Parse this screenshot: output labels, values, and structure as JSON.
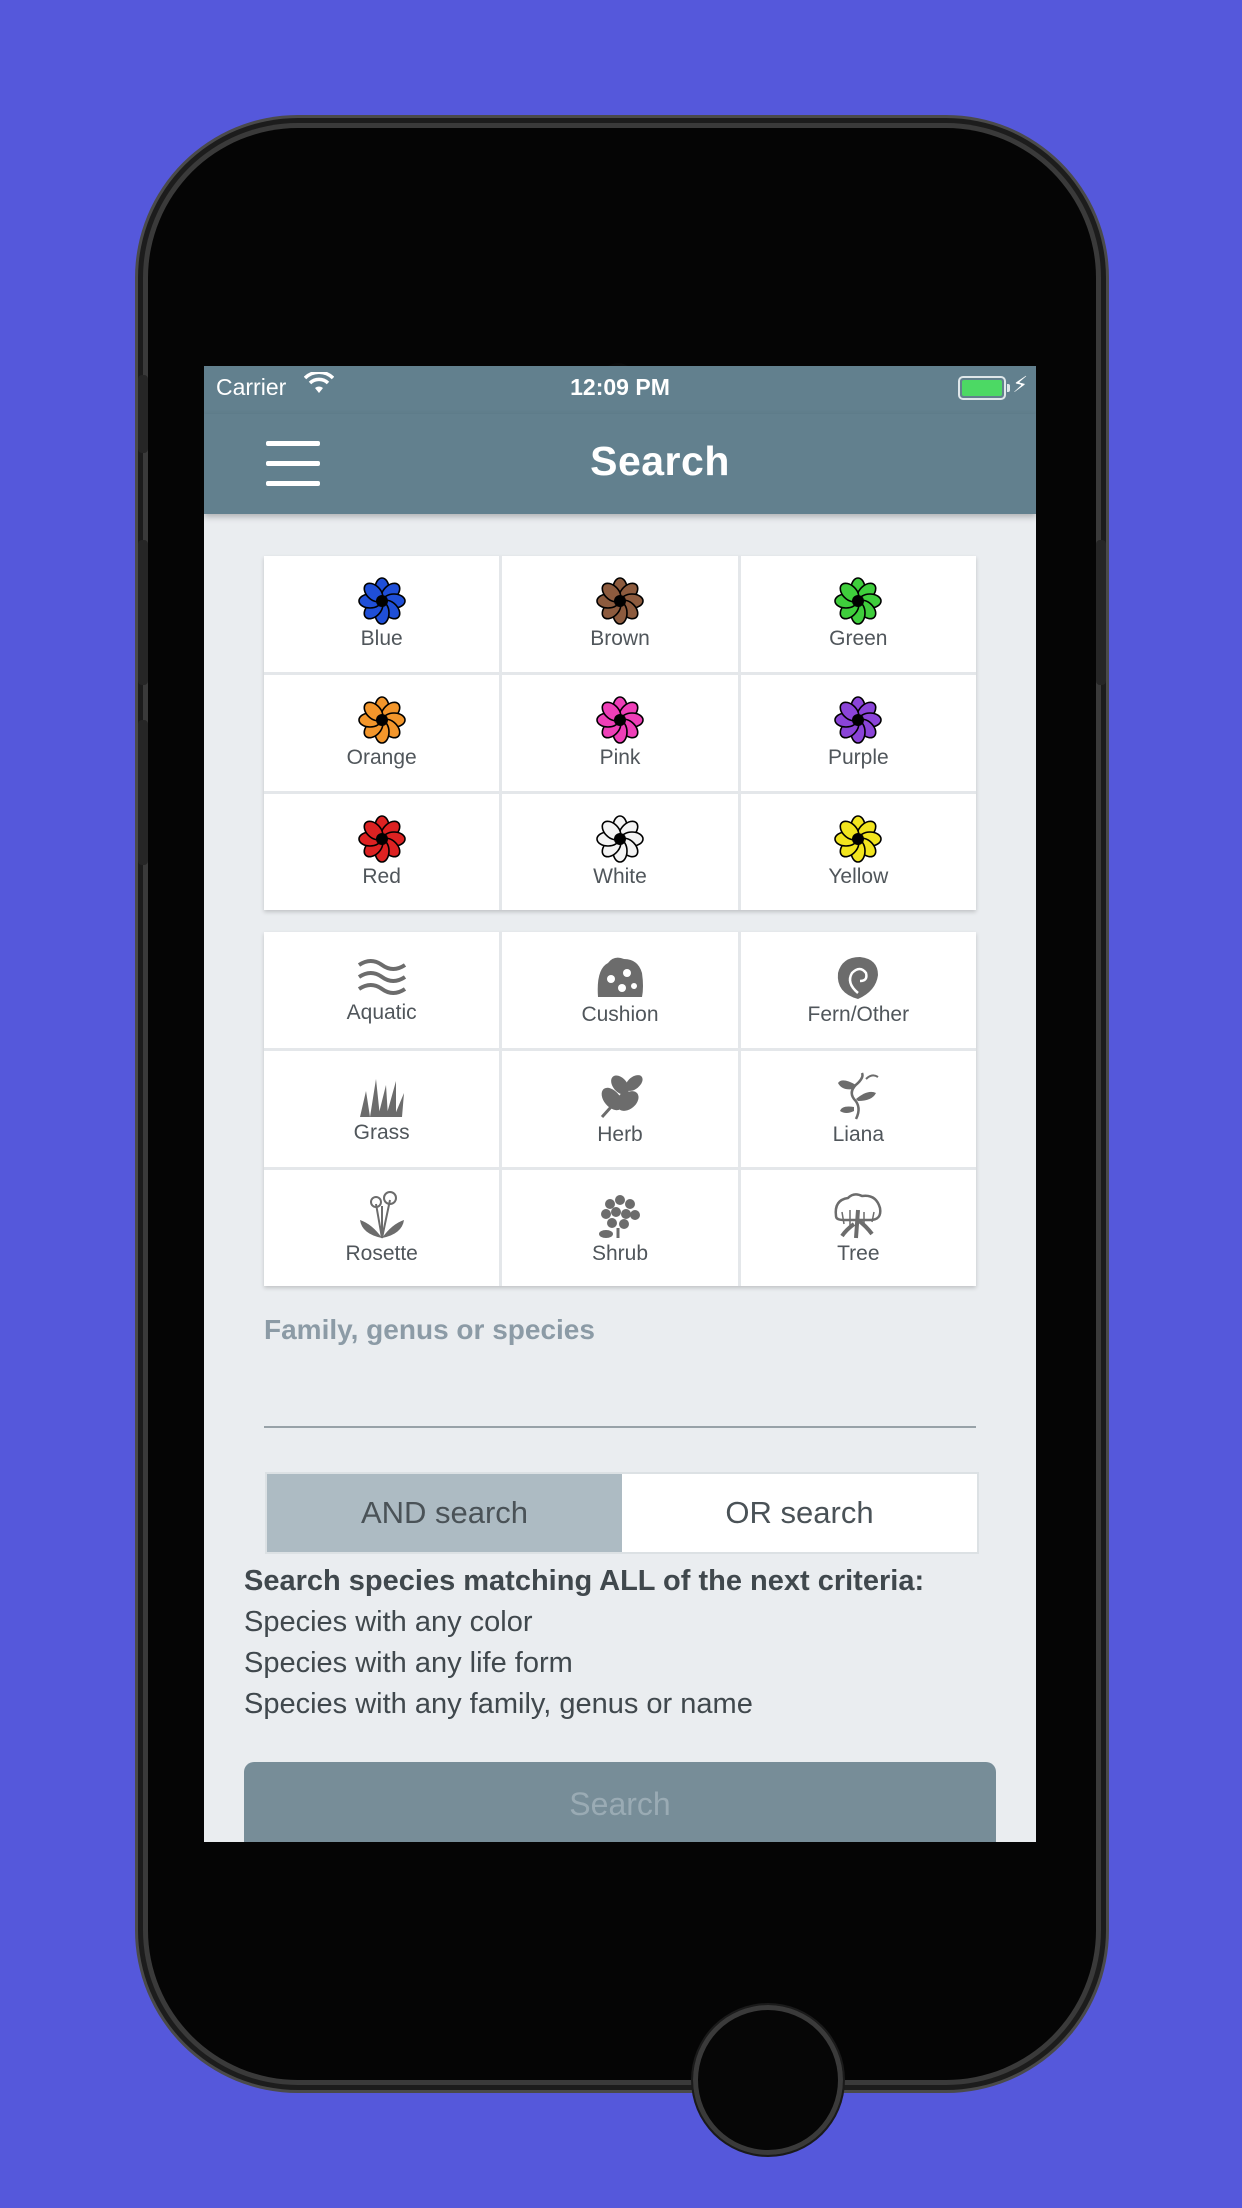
{
  "background_color": "#5558db",
  "status_bar": {
    "carrier": "Carrier",
    "time": "12:09 PM",
    "battery_color": "#4cd964"
  },
  "nav": {
    "title": "Search",
    "menu_icon": "hamburger-menu-icon"
  },
  "colors": [
    {
      "label": "Blue",
      "hex": "#1f4fd8"
    },
    {
      "label": "Brown",
      "hex": "#8d5b3e"
    },
    {
      "label": "Green",
      "hex": "#3fce3c"
    },
    {
      "label": "Orange",
      "hex": "#f3962b"
    },
    {
      "label": "Pink",
      "hex": "#ef3fb8"
    },
    {
      "label": "Purple",
      "hex": "#8b44d8"
    },
    {
      "label": "Red",
      "hex": "#dd2222"
    },
    {
      "label": "White",
      "hex": "#f4f4f4"
    },
    {
      "label": "Yellow",
      "hex": "#f2e51e"
    }
  ],
  "life_forms": [
    {
      "label": "Aquatic",
      "icon": "aquatic-waves-icon"
    },
    {
      "label": "Cushion",
      "icon": "cushion-plant-icon"
    },
    {
      "label": "Fern/Other",
      "icon": "fern-icon"
    },
    {
      "label": "Grass",
      "icon": "grass-icon"
    },
    {
      "label": "Herb",
      "icon": "herb-leaf-icon"
    },
    {
      "label": "Liana",
      "icon": "liana-vine-icon"
    },
    {
      "label": "Rosette",
      "icon": "rosette-plant-icon"
    },
    {
      "label": "Shrub",
      "icon": "shrub-icon"
    },
    {
      "label": "Tree",
      "icon": "tree-icon"
    }
  ],
  "search_field": {
    "label": "Family, genus or species",
    "value": ""
  },
  "mode": {
    "and_label": "AND search",
    "or_label": "OR search",
    "selected": "AND search"
  },
  "criteria": {
    "heading": "Search species matching ALL of the next criteria:",
    "lines": [
      "Species with any color",
      "Species with any life form",
      "Species with any family, genus or name"
    ]
  },
  "search_button": {
    "label": "Search"
  }
}
